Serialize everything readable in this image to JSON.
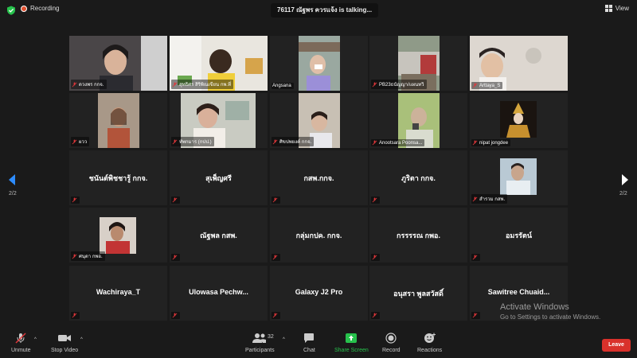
{
  "topbar": {
    "recording_label": "Recording",
    "talking_label": "76117 ณัฐพร ควรแจ้ง is talking...",
    "view_label": "View"
  },
  "nav": {
    "page_left": "2/2",
    "page_right": "2/2"
  },
  "tiles": [
    {
      "name": "ดวงพร กกจ.",
      "video": true
    },
    {
      "name": "สุทธิศร สิริพิณเขียน กพ.ที่",
      "video": true
    },
    {
      "name": "Angsana",
      "video": true
    },
    {
      "name": "PB23ธนัญญา/แผนทวิ",
      "video": true
    },
    {
      "name": "Arttaya_S",
      "video": true
    },
    {
      "name": "ผวว",
      "video": true
    },
    {
      "name": "ทัพกมาร (กปป.)",
      "video": true
    },
    {
      "name": "ศิขปพยงค์ กกจ.",
      "video": true
    },
    {
      "name": "Anootsara Poonsa...",
      "video": true
    },
    {
      "name": "nipat jongdee",
      "video": true
    },
    {
      "name": "ชนันต์พิชชารู้ กกจ.",
      "video": false
    },
    {
      "name": "สุเพ็ญศรี",
      "video": false
    },
    {
      "name": "กสพ.กกจ.",
      "video": false
    },
    {
      "name": "ภูริตา กกจ.",
      "video": false
    },
    {
      "name": "สำรวม กสพ.",
      "video": true
    },
    {
      "name": "ศนุดา กพอ.",
      "video": true
    },
    {
      "name": "ณัฐพล กสพ.",
      "video": false
    },
    {
      "name": "กลุ่มกปค. กกจ.",
      "video": false
    },
    {
      "name": "กรรรรณ กพอ.",
      "video": false
    },
    {
      "name": "อมรรัตน์",
      "video": false
    },
    {
      "name": "Wachiraya_T",
      "video": false
    },
    {
      "name": "Ulowasa Pechw...",
      "video": false
    },
    {
      "name": "Galaxy J2 Pro",
      "video": false
    },
    {
      "name": "อนุสรา พูลสวัสดิ์",
      "video": false
    },
    {
      "name": "Sawitree Chuaid...",
      "video": false
    }
  ],
  "watermark": {
    "title": "Activate Windows",
    "subtitle": "Go to Settings to activate Windows."
  },
  "toolbar": {
    "unmute": "Unmute",
    "stop_video": "Stop Video",
    "participants": "Participants",
    "participant_count": "32",
    "chat": "Chat",
    "share_screen": "Share Screen",
    "record": "Record",
    "reactions": "Reactions",
    "leave": "Leave"
  },
  "colors": {
    "share_green": "#27c24c",
    "leave_red": "#d9312b",
    "mic_off_red": "#e0373a",
    "page_arrow_blue": "#2d8cff"
  }
}
